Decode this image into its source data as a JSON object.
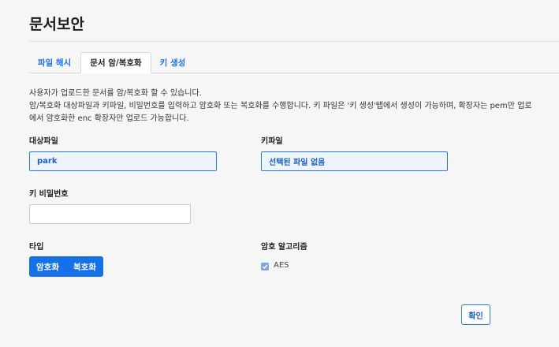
{
  "page": {
    "title": "문서보안"
  },
  "tabs": [
    {
      "label": "파일 해시"
    },
    {
      "label": "문서 암/복호화"
    },
    {
      "label": "키 생성"
    }
  ],
  "active_tab": "문서 암/복호화",
  "description": {
    "line1": "사용자가 업로드한 문서를 암/복호화 할 수 있습니다.",
    "line2": "암/복호화 대상파일과 키파일, 비밀번호를 입력하고 암호화 또는 복호화를 수행합니다. 키 파일은 '키 생성'탭에서 생성이 가능하며, 확장자는 pem만 업로",
    "line3": "에서 암호화한 enc 확장자만 업로드 가능합니다."
  },
  "form": {
    "target_file": {
      "label": "대상파일",
      "value": "park"
    },
    "key_file": {
      "label": "키파일",
      "value": "선택된 파일 없음"
    },
    "key_password": {
      "label": "키 비밀번호",
      "value": ""
    },
    "type": {
      "label": "타입",
      "options": [
        "암호화",
        "복호화"
      ]
    },
    "algorithm": {
      "label": "암호 알고리즘",
      "option": "AES",
      "checked": true
    }
  },
  "actions": {
    "confirm": "확인"
  },
  "colors": {
    "accent": "#1670e8",
    "field_border": "#2d7be0",
    "background": "#f6f6f7"
  }
}
